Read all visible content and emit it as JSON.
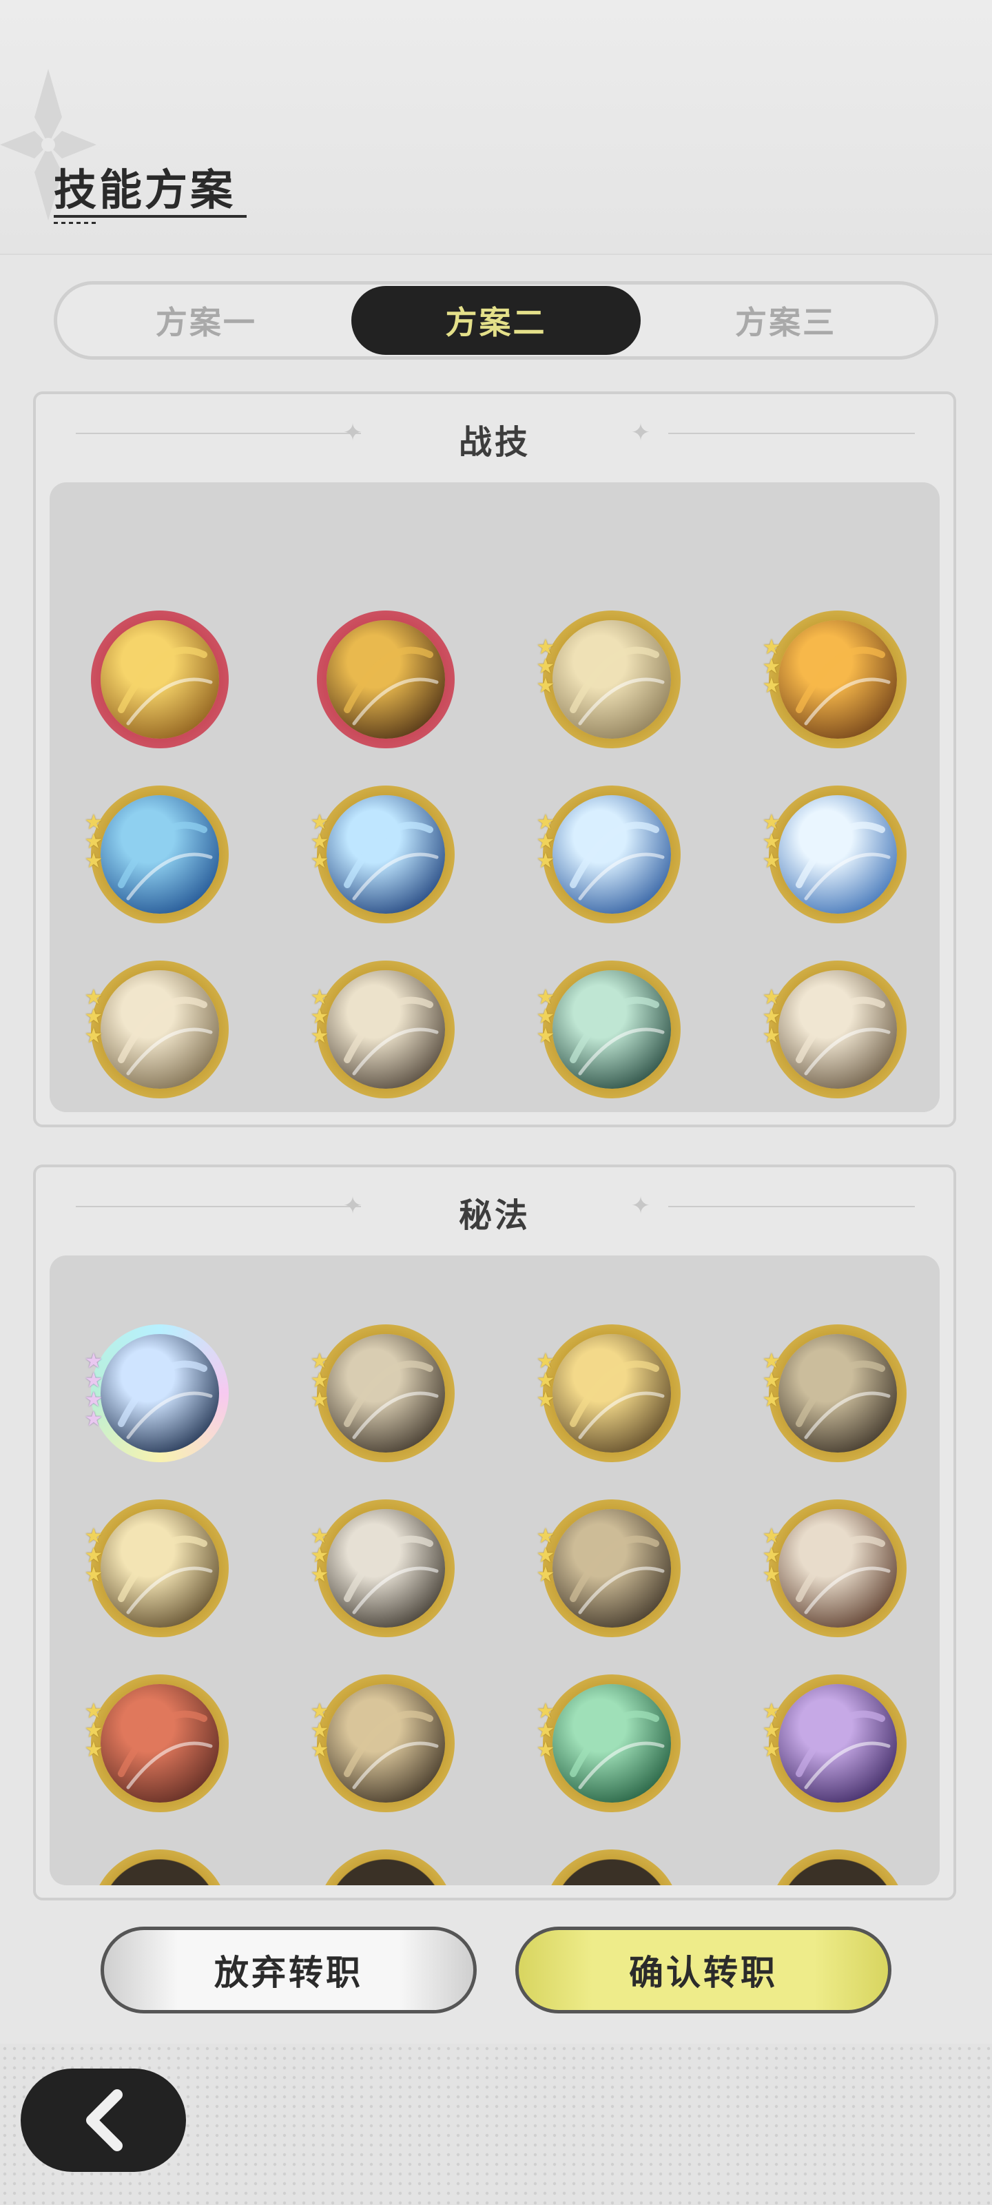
{
  "header": {
    "title": "技能方案"
  },
  "tabs": [
    {
      "label": "方案一",
      "active": false
    },
    {
      "label": "方案二",
      "active": true
    },
    {
      "label": "方案三",
      "active": false
    }
  ],
  "combat_panel": {
    "title": "战技",
    "skills": [
      {
        "icon": "golden-crescent-slash-icon",
        "frame": "red",
        "stars": 0
      },
      {
        "icon": "golden-sword-rain-icon",
        "frame": "red",
        "stars": 0
      },
      {
        "icon": "sand-swirl-icon",
        "frame": "gold",
        "stars": 3
      },
      {
        "icon": "fire-strike-icon",
        "frame": "gold",
        "stars": 3
      },
      {
        "icon": "water-wave-icon",
        "frame": "gold",
        "stars": 3
      },
      {
        "icon": "water-orb-icon",
        "frame": "gold",
        "stars": 3
      },
      {
        "icon": "ice-burst-icon",
        "frame": "gold",
        "stars": 3
      },
      {
        "icon": "frost-star-icon",
        "frame": "gold",
        "stars": 3
      },
      {
        "icon": "blade-thrust-icon",
        "frame": "gold",
        "stars": 3
      },
      {
        "icon": "wind-slash-icon",
        "frame": "gold",
        "stars": 3
      },
      {
        "icon": "jade-wind-icon",
        "frame": "gold",
        "stars": 3
      },
      {
        "icon": "ground-spikes-icon",
        "frame": "gold",
        "stars": 3
      }
    ]
  },
  "secret_panel": {
    "title": "秘法",
    "skills": [
      {
        "icon": "lightning-crystal-icon",
        "frame": "rainbow",
        "stars": 4
      },
      {
        "icon": "dragon-skull-icon",
        "frame": "gold",
        "stars": 3
      },
      {
        "icon": "runic-ring-icon",
        "frame": "gold",
        "stars": 3
      },
      {
        "icon": "cracked-heart-icon",
        "frame": "gold",
        "stars": 3
      },
      {
        "icon": "golden-shield-icon",
        "frame": "gold",
        "stars": 3
      },
      {
        "icon": "crystal-shard-icon",
        "frame": "gold",
        "stars": 3
      },
      {
        "icon": "twin-blades-icon",
        "frame": "gold",
        "stars": 3
      },
      {
        "icon": "heart-shield-icon",
        "frame": "gold",
        "stars": 3
      },
      {
        "icon": "red-rune-stone-icon",
        "frame": "gold",
        "stars": 3
      },
      {
        "icon": "armor-icon",
        "frame": "gold",
        "stars": 3
      },
      {
        "icon": "heal-heart-icon",
        "frame": "gold",
        "stars": 3
      },
      {
        "icon": "shadow-wolf-icon",
        "frame": "gold",
        "stars": 3
      }
    ]
  },
  "buttons": {
    "abandon": "放弃转职",
    "confirm": "确认转职"
  },
  "colors": {
    "accent": "#e4e08a",
    "dark": "#222222",
    "gold_frame": "#c9a43a",
    "red_frame": "#c94a5a",
    "confirm_bg": "#eeec8a"
  }
}
